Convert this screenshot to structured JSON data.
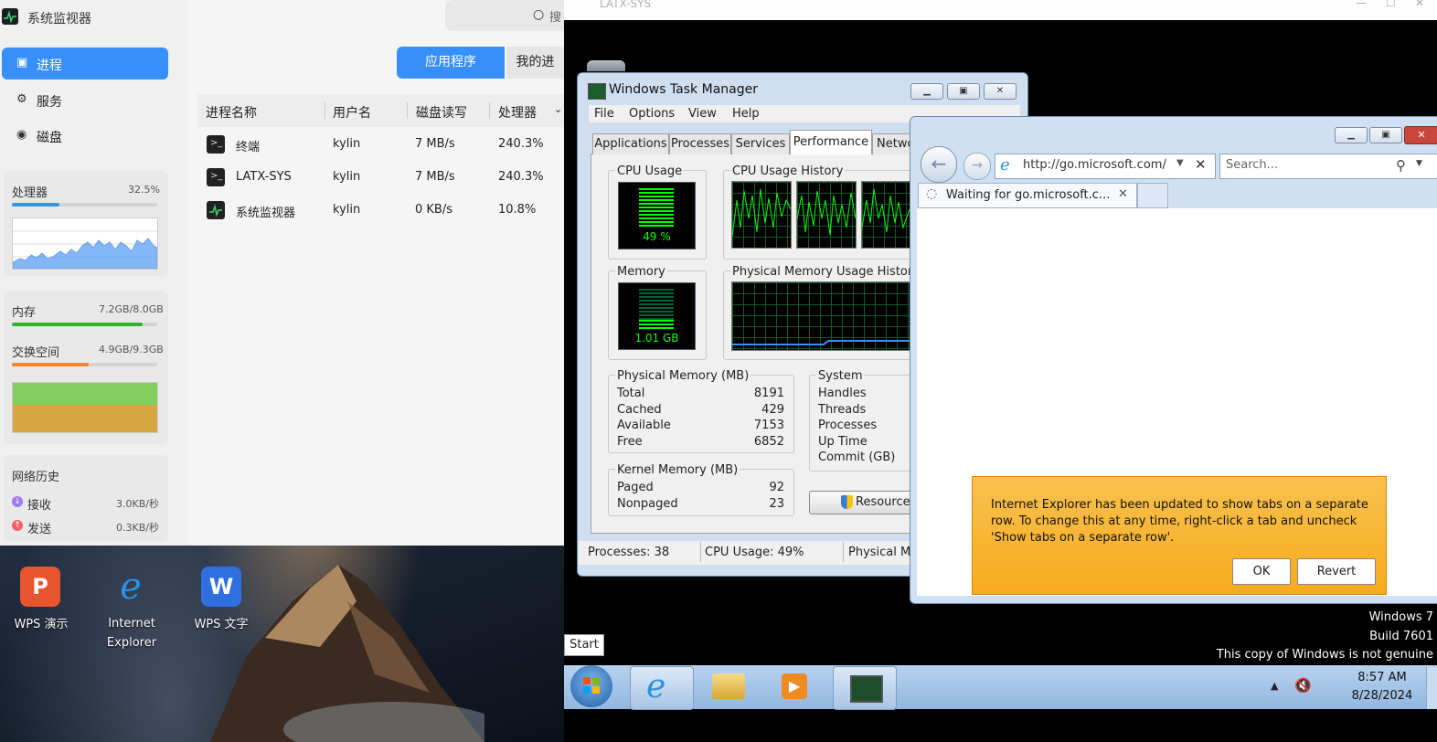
{
  "sysmon": {
    "title": "系统监视器",
    "search_placeholder": "搜",
    "nav": [
      {
        "label": "进程",
        "icon": "process-icon"
      },
      {
        "label": "服务",
        "icon": "service-icon"
      },
      {
        "label": "磁盘",
        "icon": "disk-icon"
      }
    ],
    "cpu": {
      "label": "处理器",
      "value": "32.5%",
      "fraction": 0.325
    },
    "memory": {
      "label": "内存",
      "value": "7.2GB/8.0GB",
      "fraction": 0.9
    },
    "swap": {
      "label": "交换空间",
      "value": "4.9GB/9.3GB",
      "fraction": 0.527
    },
    "network": {
      "title": "网络历史",
      "recv_label": "接收",
      "recv_value": "3.0KB/秒",
      "send_label": "发送",
      "send_value": "0.3KB/秒"
    },
    "segments": {
      "apps": "应用程序",
      "mine": "我的进"
    },
    "columns": [
      "进程名称",
      "用户名",
      "磁盘读写",
      "处理器"
    ],
    "rows": [
      {
        "name": "终端",
        "user": "kylin",
        "disk": "7 MB/s",
        "cpu": "240.3%"
      },
      {
        "name": "LATX-SYS",
        "user": "kylin",
        "disk": "7 MB/s",
        "cpu": "240.3%"
      },
      {
        "name": "系统监视器",
        "user": "kylin",
        "disk": "0 KB/s",
        "cpu": "10.8%"
      }
    ]
  },
  "desktop_icons": [
    {
      "label": "WPS 演示"
    },
    {
      "label": "Internet\nExplorer"
    },
    {
      "label": "WPS 文字"
    }
  ],
  "vm": {
    "title": "LATX-SYS",
    "watermark": {
      "line1": "Windows 7",
      "line2": "Build 7601",
      "line3": "This copy of Windows is not genuine"
    },
    "start_label": "Start",
    "clock_time": "8:57 AM",
    "clock_date": "8/28/2024"
  },
  "task_manager": {
    "title": "Windows Task Manager",
    "menu": [
      "File",
      "Options",
      "View",
      "Help"
    ],
    "tabs": [
      "Applications",
      "Processes",
      "Services",
      "Performance",
      "Netwo"
    ],
    "cpu_usage_label": "CPU Usage",
    "cpu_usage_value": "49 %",
    "cpu_history_label": "CPU Usage History",
    "memory_label": "Memory",
    "memory_value": "1.01 GB",
    "phys_history_label": "Physical Memory Usage History",
    "physical_memory": {
      "title": "Physical Memory (MB)",
      "rows": [
        {
          "k": "Total",
          "v": "8191"
        },
        {
          "k": "Cached",
          "v": "429"
        },
        {
          "k": "Available",
          "v": "7153"
        },
        {
          "k": "Free",
          "v": "6852"
        }
      ]
    },
    "system": {
      "title": "System",
      "rows": [
        "Handles",
        "Threads",
        "Processes",
        "Up Time",
        "Commit (GB)"
      ]
    },
    "kernel_memory": {
      "title": "Kernel Memory (MB)",
      "rows": [
        {
          "k": "Paged",
          "v": "92"
        },
        {
          "k": "Nonpaged",
          "v": "23"
        }
      ]
    },
    "resource_button": "Resource",
    "status": {
      "processes": "Processes: 38",
      "cpu": "CPU Usage: 49%",
      "phys": "Physical M"
    }
  },
  "ie": {
    "address": "http://go.microsoft.com/",
    "search_placeholder": "Search...",
    "tab_label": "Waiting for go.microsoft.c...",
    "notice_text": "Internet Explorer has been updated to show tabs on a separate row. To change this at any time, right-click a tab and uncheck 'Show tabs on a separate row'.",
    "ok_label": "OK",
    "revert_label": "Revert"
  }
}
